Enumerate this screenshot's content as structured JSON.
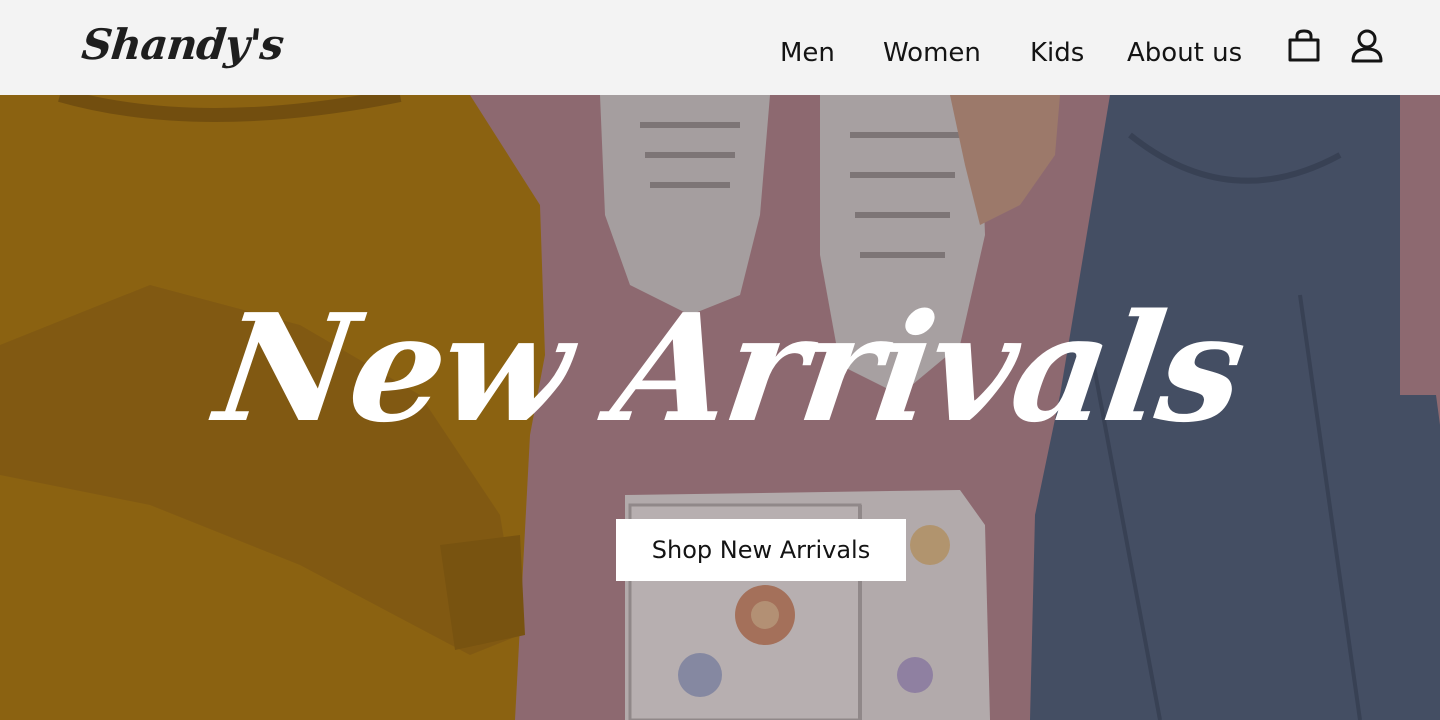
{
  "brand": {
    "logo_text": "Shandy's"
  },
  "nav": {
    "items": [
      {
        "label": "Men"
      },
      {
        "label": "Women"
      },
      {
        "label": "Kids"
      },
      {
        "label": "About us"
      }
    ],
    "icons": [
      "shopping-bag-icon",
      "user-icon"
    ]
  },
  "hero": {
    "headline": "New Arrivals",
    "cta_label": "Shop New Arrivals",
    "background_image": "flat-lay of mustard sweater, white sneakers, floral purse and blue jeans on pink background"
  },
  "colors": {
    "header_bg": "#f3f3f3",
    "text_dark": "#141414",
    "hero_pink": "#8a5a62",
    "sweater": "#a8770f",
    "denim": "#4d5f78",
    "cta_bg": "#ffffff"
  }
}
